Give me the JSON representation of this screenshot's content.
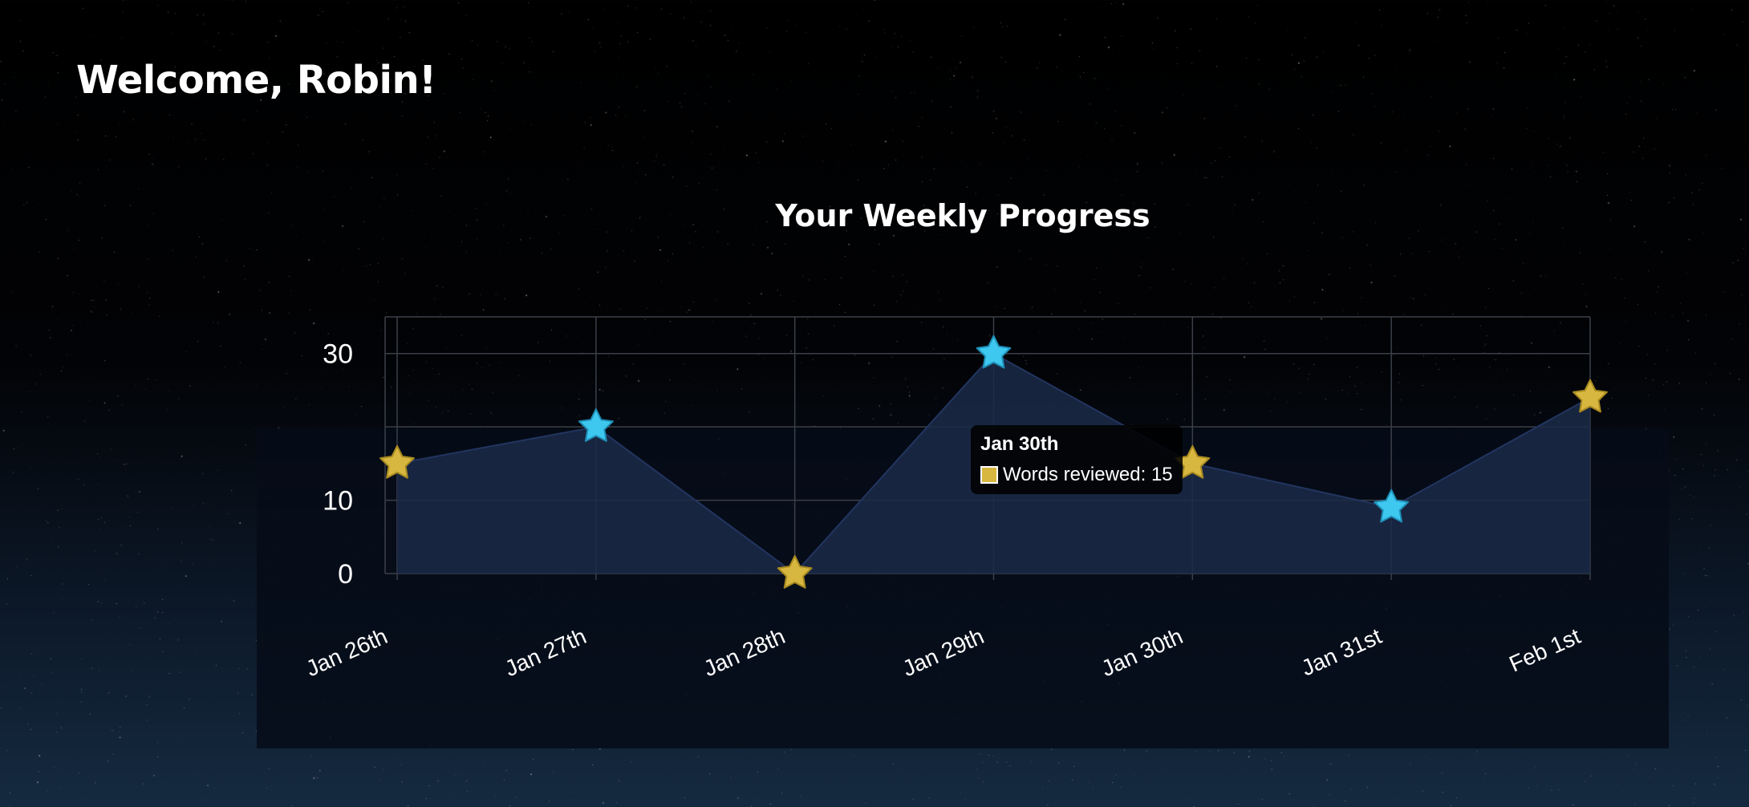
{
  "header": {
    "welcome": "Welcome, Robin!"
  },
  "colors": {
    "gold_star": "#d8b740",
    "blue_star": "#3ec8f0",
    "area_fill": "#1b2a48",
    "grid": "#3a3f48",
    "text": "#ffffff"
  },
  "chart_data": {
    "type": "area",
    "title": "Your Weekly Progress",
    "xlabel": "",
    "ylabel": "",
    "categories": [
      "Jan 26th",
      "Jan 27th",
      "Jan 28th",
      "Jan 29th",
      "Jan 30th",
      "Jan 31st",
      "Feb 1st"
    ],
    "series": [
      {
        "name": "Words reviewed",
        "values": [
          15,
          20,
          0,
          30,
          15,
          9,
          24
        ],
        "point_style": "star",
        "point_colors": [
          "gold",
          "blue",
          "gold",
          "blue",
          "gold",
          "blue",
          "gold"
        ]
      }
    ],
    "ylim": [
      0,
      35
    ],
    "yticks": [
      0,
      10,
      30
    ],
    "grid": true,
    "tooltip": {
      "title": "Jan 30th",
      "label": "Words reviewed: 15",
      "swatch_color": "#d8b740"
    }
  }
}
